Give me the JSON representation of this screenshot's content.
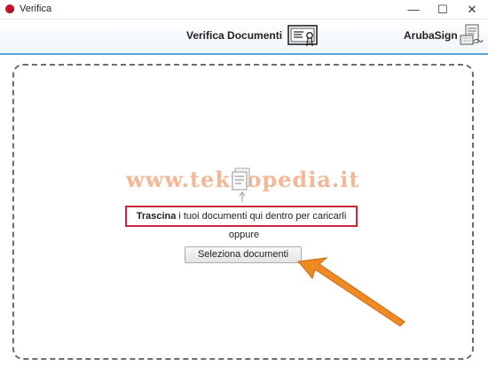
{
  "window": {
    "title": "Verifica",
    "minimize_glyph": "—",
    "maximize_glyph": "☐",
    "close_glyph": "✕"
  },
  "header": {
    "title": "Verifica Documenti",
    "brand": "ArubaSign",
    "title_icon": "certificate-icon",
    "brand_icon": "arubasign-logo-icon",
    "accent_color": "#5aa7dd"
  },
  "dropzone": {
    "watermark": "www.teknopedia.it",
    "instruction_bold": "Trascina",
    "instruction_rest": "i tuoi documenti qui dentro per caricarli",
    "or_label": "oppure",
    "select_button_label": "Seleziona documenti",
    "highlight_color": "#c8283c",
    "arrow_color": "#f08a24"
  }
}
